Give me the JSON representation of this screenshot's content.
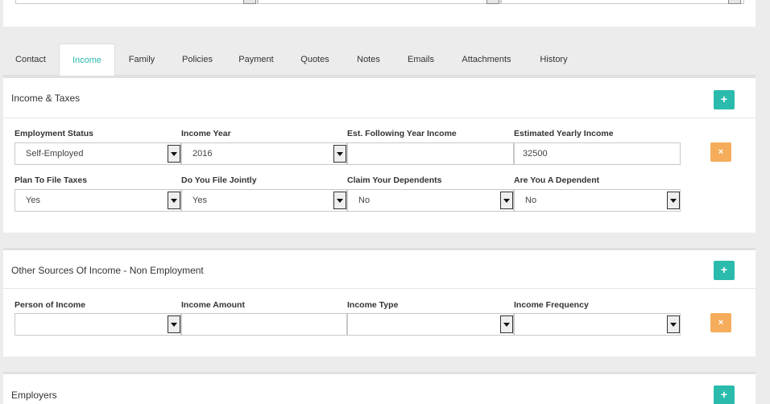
{
  "tabs": [
    {
      "label": "Contact",
      "active": false
    },
    {
      "label": "Income",
      "active": true
    },
    {
      "label": "Family",
      "active": false
    },
    {
      "label": "Policies",
      "active": false
    },
    {
      "label": "Payment",
      "active": false
    },
    {
      "label": "Quotes",
      "active": false
    },
    {
      "label": "Notes",
      "active": false
    },
    {
      "label": "Emails",
      "active": false
    },
    {
      "label": "Attachments",
      "active": false
    },
    {
      "label": "History",
      "active": false
    }
  ],
  "colors": {
    "accent": "#2bbbad",
    "remove": "#f5ad5c"
  },
  "income_taxes": {
    "title": "Income & Taxes",
    "add_label": "+",
    "remove_label": "×",
    "employment_status": {
      "label": "Employment Status",
      "value": "Self-Employed"
    },
    "income_year": {
      "label": "Income Year",
      "value": "2016"
    },
    "est_following": {
      "label": "Est. Following Year Income",
      "value": ""
    },
    "estimated_yearly": {
      "label": "Estimated Yearly Income",
      "value": "32500"
    },
    "plan_file": {
      "label": "Plan To File Taxes",
      "value": "Yes"
    },
    "file_jointly": {
      "label": "Do You File Jointly",
      "value": "Yes"
    },
    "claim_dependents": {
      "label": "Claim Your Dependents",
      "value": "No"
    },
    "are_dependent": {
      "label": "Are You A Dependent",
      "value": "No"
    }
  },
  "other_income": {
    "title": "Other Sources Of Income - Non Employment",
    "add_label": "+",
    "remove_label": "×",
    "person": {
      "label": "Person of Income",
      "value": ""
    },
    "amount": {
      "label": "Income Amount",
      "value": ""
    },
    "type": {
      "label": "Income Type",
      "value": ""
    },
    "frequency": {
      "label": "Income Frequency",
      "value": ""
    }
  },
  "employers": {
    "title": "Employers",
    "add_label": "+"
  }
}
